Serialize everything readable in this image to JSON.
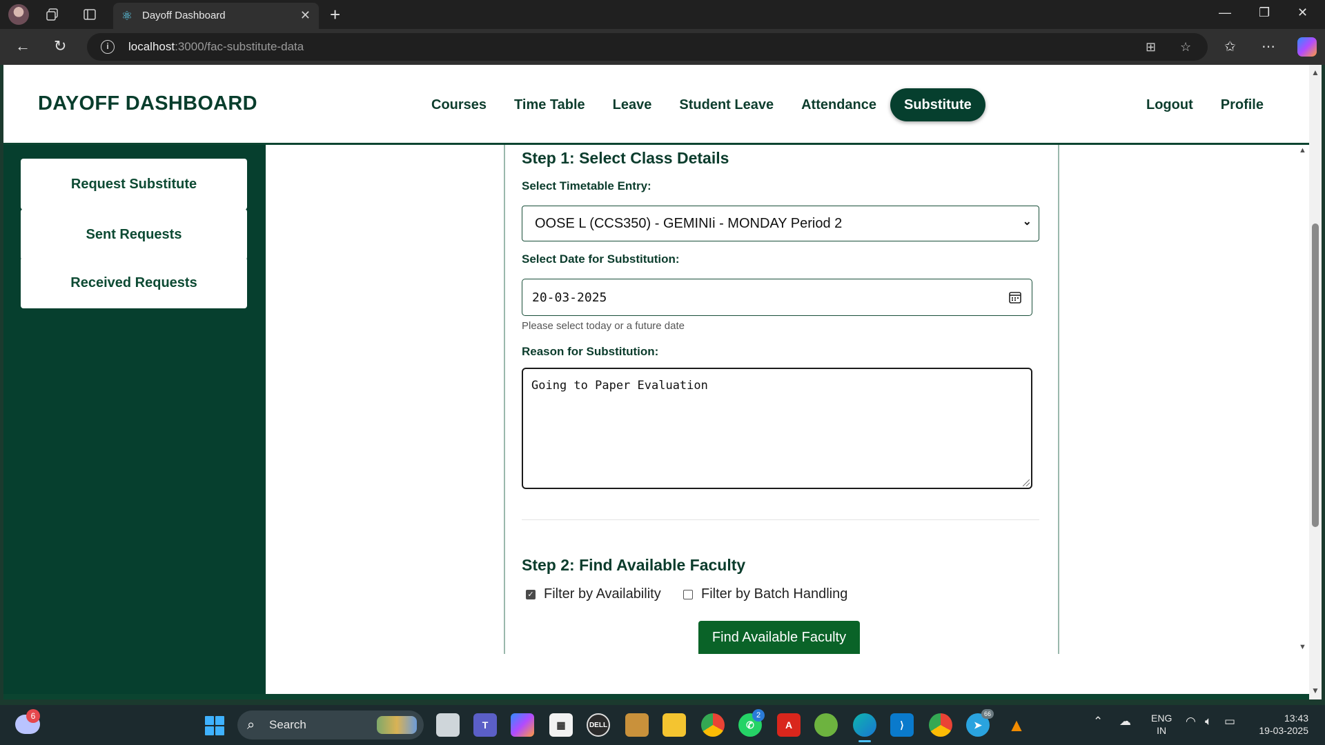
{
  "browser": {
    "tab_title": "Dayoff Dashboard",
    "url_host": "localhost",
    "url_path": ":3000/fac-substitute-data"
  },
  "app": {
    "brand": "DAYOFF DASHBOARD",
    "nav": [
      "Courses",
      "Time Table",
      "Leave",
      "Student Leave",
      "Attendance",
      "Substitute"
    ],
    "nav_active": "Substitute",
    "nav_right": [
      "Logout",
      "Profile"
    ]
  },
  "sidebar": {
    "items": [
      "Request Substitute",
      "Sent Requests",
      "Received Requests"
    ]
  },
  "form": {
    "step1_heading": "Step 1: Select Class Details",
    "timetable_label": "Select Timetable Entry:",
    "timetable_value": "OOSE L (CCS350) - GEMINIi - MONDAY Period 2",
    "date_label": "Select Date for Substitution:",
    "date_value": "20-03-2025",
    "date_hint": "Please select today or a future date",
    "reason_label": "Reason for Substitution:",
    "reason_value": "Going to Paper Evaluation",
    "step2_heading": "Step 2: Find Available Faculty",
    "filter_availability": "Filter by Availability",
    "filter_availability_checked": true,
    "filter_batch": "Filter by Batch Handling",
    "filter_batch_checked": false,
    "find_button": "Find Available Faculty"
  },
  "taskbar": {
    "search_label": "Search",
    "weather_badge": "6",
    "whatsapp_badge": "2",
    "telegram_badge": "66",
    "lang_line1": "ENG",
    "lang_line2": "IN",
    "time": "13:43",
    "date": "19-03-2025"
  },
  "colors": {
    "brand_green": "#063f2e",
    "button_green": "#0a6328"
  }
}
